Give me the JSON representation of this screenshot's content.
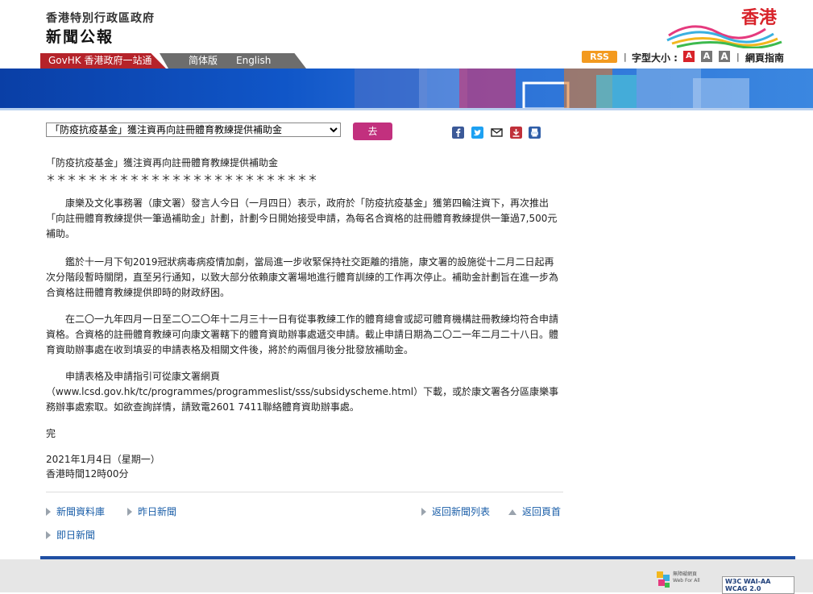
{
  "header": {
    "gov_name": "香港特別行政區政府",
    "press_name": "新聞公報",
    "logo_text": "香港",
    "govhk_label": "GovHK 香港政府一站通",
    "lang_simplified": "简体版",
    "lang_english": "English",
    "rss_label": "RSS",
    "font_size_label": "字型大小 :",
    "font_buttons": [
      "A",
      "A",
      "A"
    ],
    "sitemap_label": "網頁指南"
  },
  "toolbar": {
    "select_value": "「防疫抗疫基金」獲注資再向註冊體育教練提供補助金",
    "go_label": "去",
    "share_icons": [
      "facebook-icon",
      "twitter-icon",
      "email-icon",
      "download-icon",
      "print-icon"
    ]
  },
  "article": {
    "title": "「防疫抗疫基金」獲注資再向註冊體育教練提供補助金",
    "stars": "＊＊＊＊＊＊＊＊＊＊＊＊＊＊＊＊＊＊＊＊＊＊＊＊＊＊",
    "paragraphs": [
      "康樂及文化事務署（康文署）發言人今日（一月四日）表示，政府於「防疫抗疫基金」獲第四輪注資下，再次推出「向註冊體育教練提供一筆過補助金」計劃，計劃今日開始接受申請，為每名合資格的註冊體育教練提供一筆過7,500元補助。",
      "鑑於十一月下旬2019冠狀病毒病疫情加劇，當局進一步收緊保持社交距離的措施，康文署的設施從十二月二日起再次分階段暫時關閉，直至另行通知，以致大部分依賴康文署場地進行體育訓練的工作再次停止。補助金計劃旨在進一步為合資格註冊體育教練提供即時的財政紓困。",
      "在二〇一九年四月一日至二〇二〇年十二月三十一日有從事教練工作的體育總會或認可體育機構註冊教練均符合申請資格。合資格的註冊體育教練可向康文署轄下的體育資助辦事處遞交申請。截止申請日期為二〇二一年二月二十八日。體育資助辦事處在收到填妥的申請表格及相關文件後，將於約兩個月後分批發放補助金。",
      "申請表格及申請指引可從康文署網頁（www.lcsd.gov.hk/tc/programmes/programmeslist/sss/subsidyscheme.html）下載，或於康文署各分區康樂事務辦事處索取。如欲查詢詳情，請致電2601 7411聯絡體育資助辦事處。"
    ],
    "end": "完",
    "date": "2021年1月4日（星期一）",
    "time": "香港時間12時00分"
  },
  "footer_links": {
    "archive": "新聞資料庫",
    "yesterday": "昨日新聞",
    "back_list": "返回新聞列表",
    "back_top": "返回頁首",
    "today": "即日新聞"
  },
  "badges": {
    "web_for_all": "無障礙網頁 Web For All",
    "wcag": "W3C WAI-AA WCAG 2.0"
  },
  "colors": {
    "govhk_red": "#b5232a",
    "go_button": "#c2307e",
    "rss_orange": "#f39a1f",
    "link_blue": "#1a5ea8",
    "footer_blue": "#1f4fa3"
  }
}
